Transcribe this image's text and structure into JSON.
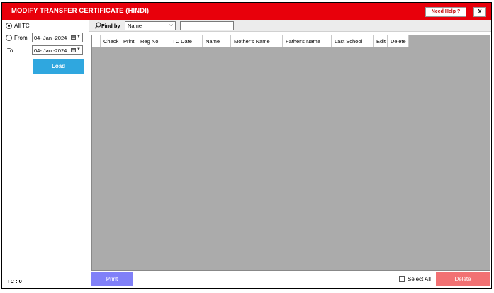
{
  "window": {
    "title": "MODIFY TRANSFER CERTIFICATE (HINDI)",
    "help_label": "Need Help ?",
    "close_label": "X"
  },
  "filter": {
    "all_tc_label": "All TC",
    "from_label": "From",
    "to_label": "To",
    "from_date": "04- Jan -2024",
    "to_date": "04- Jan -2024",
    "load_label": "Load",
    "selected_option": "All TC"
  },
  "search": {
    "find_by_label": "Find by",
    "find_by_value": "Name",
    "query": "",
    "icon": "search-icon"
  },
  "grid": {
    "columns": [
      "Check",
      "Print",
      "Reg No",
      "TC Date",
      "Name",
      "Mother's Name",
      "Father's Name",
      "Last School",
      "Edit",
      "Delete"
    ],
    "rows": []
  },
  "footer": {
    "tc_count_label": "TC : 0",
    "print_label": "Print",
    "select_all_label": "Select All",
    "delete_label": "Delete"
  },
  "colors": {
    "title_bar": "#e8000b",
    "load_button": "#2fa7df",
    "print_button": "#8080f8",
    "delete_button": "#f27173",
    "grid_background": "#ababab"
  }
}
